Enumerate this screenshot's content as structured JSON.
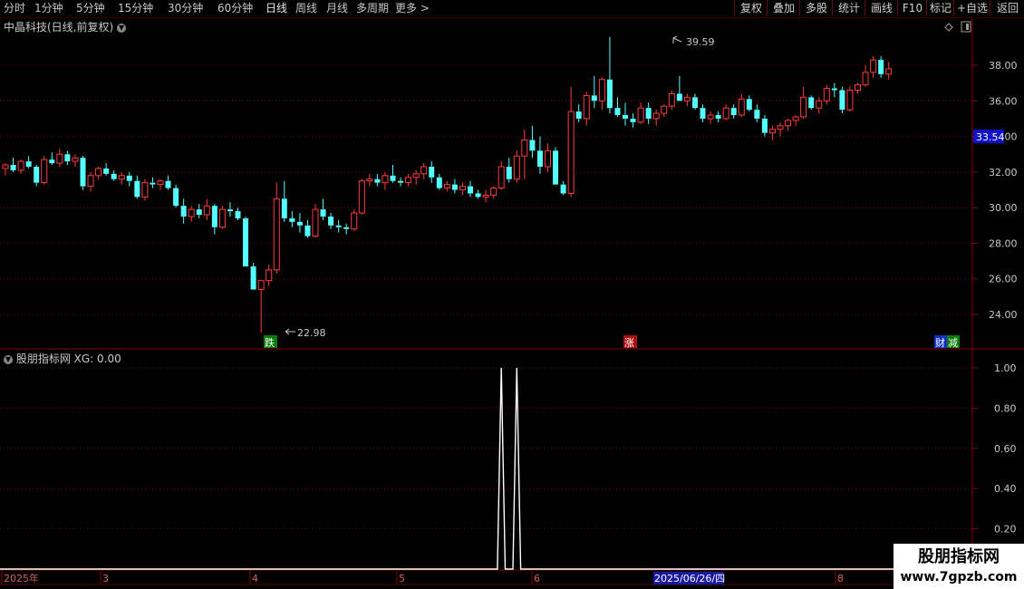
{
  "toolbar": {
    "periods": [
      "分时",
      "1分钟",
      "5分钟",
      "15分钟",
      "30分钟",
      "60分钟",
      "日线",
      "周线",
      "月线",
      "多周期",
      "更多 >"
    ],
    "active_period": "日线",
    "right_buttons": [
      "复权",
      "叠加",
      "多股",
      "统计",
      "画线",
      "F10",
      "标记",
      "+自选",
      "返回"
    ]
  },
  "main_chart": {
    "title": "中晶科技(日线,前复权)",
    "price_ticks": [
      "38.00",
      "36.00",
      "34.00",
      "32.00",
      "30.00",
      "28.00",
      "26.00",
      "24.00"
    ],
    "high_label": "39.59",
    "low_label": "22.98",
    "current_price": "33.54",
    "markers": [
      "跌",
      "涨",
      "财",
      "减"
    ],
    "colors": {
      "up": "#ff3c3c",
      "down": "#54ffff",
      "current_bg": "#1010c8"
    }
  },
  "indicator": {
    "title": "股朋指标网 XG: 0.00",
    "ticks": [
      "1.00",
      "0.80",
      "0.60",
      "0.40",
      "0.20"
    ],
    "signals": [
      {
        "index": 64,
        "value": 1.0
      },
      {
        "index": 66,
        "value": 1.0
      }
    ]
  },
  "time_axis": {
    "labels": [
      "2025年",
      "3",
      "4",
      "5",
      "6",
      "8"
    ],
    "cursor_date": "2025/06/26/四"
  },
  "watermark": {
    "line1": "股朋指标网",
    "line2": "www.7gpzb.com"
  },
  "chart_data": {
    "type": "candlestick",
    "y_unit": "price",
    "ylim": [
      22.5,
      40.5
    ],
    "candles": [
      [
        32.2,
        32.5,
        31.8,
        32.4
      ],
      [
        32.4,
        32.8,
        32.0,
        32.1
      ],
      [
        32.1,
        32.7,
        31.9,
        32.6
      ],
      [
        32.6,
        32.9,
        32.2,
        32.3
      ],
      [
        32.3,
        32.4,
        31.2,
        31.4
      ],
      [
        31.4,
        32.9,
        31.3,
        32.7
      ],
      [
        32.7,
        33.1,
        32.4,
        32.5
      ],
      [
        32.5,
        33.3,
        32.3,
        33.0
      ],
      [
        33.0,
        33.2,
        32.4,
        32.6
      ],
      [
        32.6,
        33.0,
        32.3,
        32.8
      ],
      [
        32.8,
        32.9,
        31.0,
        31.2
      ],
      [
        31.2,
        32.0,
        30.9,
        31.8
      ],
      [
        31.8,
        32.3,
        31.6,
        32.2
      ],
      [
        32.2,
        32.5,
        31.8,
        31.9
      ],
      [
        31.9,
        32.1,
        31.5,
        31.6
      ],
      [
        31.6,
        32.0,
        31.3,
        31.8
      ],
      [
        31.8,
        32.0,
        31.2,
        31.5
      ],
      [
        31.5,
        31.8,
        30.5,
        30.6
      ],
      [
        30.6,
        31.6,
        30.4,
        31.4
      ],
      [
        31.4,
        31.7,
        31.1,
        31.3
      ],
      [
        31.3,
        31.6,
        31.0,
        31.5
      ],
      [
        31.5,
        31.8,
        31.0,
        31.1
      ],
      [
        31.1,
        31.3,
        30.0,
        30.1
      ],
      [
        30.1,
        30.5,
        29.1,
        29.5
      ],
      [
        29.5,
        30.1,
        29.2,
        29.9
      ],
      [
        29.9,
        30.2,
        29.4,
        29.6
      ],
      [
        29.6,
        30.5,
        29.3,
        30.1
      ],
      [
        30.1,
        30.2,
        28.5,
        28.9
      ],
      [
        28.9,
        30.1,
        28.8,
        29.9
      ],
      [
        29.9,
        30.3,
        29.5,
        29.8
      ],
      [
        29.8,
        30.0,
        29.3,
        29.4
      ],
      [
        29.4,
        29.5,
        27.0,
        26.7
      ],
      [
        26.7,
        26.9,
        25.5,
        25.4
      ],
      [
        25.4,
        25.6,
        22.98,
        25.9
      ],
      [
        25.9,
        26.8,
        25.6,
        26.5
      ],
      [
        26.5,
        31.4,
        26.3,
        30.5
      ],
      [
        30.5,
        31.5,
        29.2,
        29.4
      ],
      [
        29.4,
        29.8,
        28.9,
        29.2
      ],
      [
        29.2,
        29.7,
        28.6,
        29.0
      ],
      [
        29.0,
        29.3,
        28.3,
        28.4
      ],
      [
        28.4,
        30.2,
        28.3,
        29.9
      ],
      [
        29.9,
        30.5,
        29.3,
        29.5
      ],
      [
        29.5,
        29.7,
        28.8,
        29.0
      ],
      [
        29.0,
        29.3,
        28.6,
        28.9
      ],
      [
        28.9,
        29.1,
        28.5,
        28.8
      ],
      [
        28.8,
        29.9,
        28.7,
        29.7
      ],
      [
        29.7,
        31.6,
        29.6,
        31.5
      ],
      [
        31.5,
        31.9,
        31.2,
        31.6
      ],
      [
        31.6,
        31.9,
        31.2,
        31.4
      ],
      [
        31.4,
        32.0,
        31.0,
        31.8
      ],
      [
        31.8,
        32.4,
        31.4,
        31.5
      ],
      [
        31.5,
        31.7,
        31.2,
        31.4
      ],
      [
        31.4,
        31.9,
        31.2,
        31.7
      ],
      [
        31.7,
        32.1,
        31.3,
        31.9
      ],
      [
        31.9,
        32.5,
        31.6,
        32.3
      ],
      [
        32.3,
        32.6,
        31.4,
        31.7
      ],
      [
        31.7,
        31.9,
        31.0,
        31.1
      ],
      [
        31.1,
        31.5,
        30.9,
        31.3
      ],
      [
        31.3,
        31.6,
        30.8,
        31.0
      ],
      [
        31.0,
        31.4,
        30.7,
        31.2
      ],
      [
        31.2,
        31.5,
        30.6,
        30.8
      ],
      [
        30.8,
        31.0,
        30.5,
        30.6
      ],
      [
        30.6,
        31.0,
        30.3,
        30.7
      ],
      [
        30.7,
        31.2,
        30.5,
        31.1
      ],
      [
        31.1,
        32.6,
        31.0,
        32.3
      ],
      [
        32.3,
        32.8,
        31.4,
        31.6
      ],
      [
        31.6,
        33.2,
        31.4,
        32.9
      ],
      [
        32.9,
        34.4,
        31.6,
        33.8
      ],
      [
        33.8,
        34.6,
        32.8,
        33.2
      ],
      [
        33.2,
        34.0,
        31.9,
        32.3
      ],
      [
        32.3,
        33.6,
        32.0,
        33.2
      ],
      [
        33.2,
        33.4,
        31.7,
        31.3
      ],
      [
        31.3,
        31.5,
        30.7,
        30.8
      ],
      [
        30.8,
        36.8,
        30.6,
        35.4
      ],
      [
        35.4,
        35.8,
        34.8,
        35.0
      ],
      [
        35.0,
        36.5,
        34.6,
        36.3
      ],
      [
        36.3,
        37.4,
        35.6,
        36.0
      ],
      [
        36.0,
        37.3,
        35.5,
        37.2
      ],
      [
        37.2,
        39.59,
        35.3,
        35.6
      ],
      [
        35.6,
        36.2,
        35.1,
        35.2
      ],
      [
        35.2,
        35.9,
        34.6,
        35.0
      ],
      [
        35.0,
        35.3,
        34.5,
        34.8
      ],
      [
        34.8,
        35.9,
        34.7,
        35.6
      ],
      [
        35.6,
        35.9,
        34.7,
        35.0
      ],
      [
        35.0,
        35.5,
        34.6,
        35.3
      ],
      [
        35.3,
        35.8,
        35.1,
        35.7
      ],
      [
        35.7,
        36.6,
        35.5,
        36.4
      ],
      [
        36.4,
        37.4,
        36.0,
        36.0
      ],
      [
        36.0,
        36.4,
        35.7,
        36.2
      ],
      [
        36.2,
        36.4,
        35.5,
        35.6
      ],
      [
        35.6,
        35.8,
        34.8,
        35.0
      ],
      [
        35.0,
        35.4,
        34.7,
        35.2
      ],
      [
        35.2,
        35.4,
        34.8,
        35.0
      ],
      [
        35.0,
        35.8,
        34.9,
        35.6
      ],
      [
        35.6,
        35.8,
        35.0,
        35.2
      ],
      [
        35.2,
        36.4,
        35.1,
        36.1
      ],
      [
        36.1,
        36.3,
        35.4,
        35.5
      ],
      [
        35.5,
        35.8,
        34.8,
        35.0
      ],
      [
        35.0,
        35.2,
        34.0,
        34.2
      ],
      [
        34.2,
        34.6,
        33.8,
        34.4
      ],
      [
        34.4,
        34.8,
        34.0,
        34.6
      ],
      [
        34.6,
        35.0,
        34.3,
        34.9
      ],
      [
        34.9,
        35.2,
        34.6,
        35.1
      ],
      [
        35.1,
        36.8,
        35.0,
        36.2
      ],
      [
        36.2,
        36.3,
        35.5,
        35.6
      ],
      [
        35.6,
        36.2,
        35.3,
        36.0
      ],
      [
        36.0,
        36.9,
        35.8,
        36.7
      ],
      [
        36.7,
        37.0,
        36.2,
        36.6
      ],
      [
        36.6,
        36.8,
        35.3,
        35.5
      ],
      [
        35.5,
        36.8,
        35.4,
        36.6
      ],
      [
        36.6,
        37.0,
        36.4,
        36.9
      ],
      [
        36.9,
        38.0,
        36.8,
        37.6
      ],
      [
        37.6,
        38.5,
        37.3,
        38.3
      ],
      [
        38.3,
        38.5,
        37.3,
        37.5
      ],
      [
        37.5,
        38.2,
        37.2,
        37.8
      ]
    ]
  }
}
